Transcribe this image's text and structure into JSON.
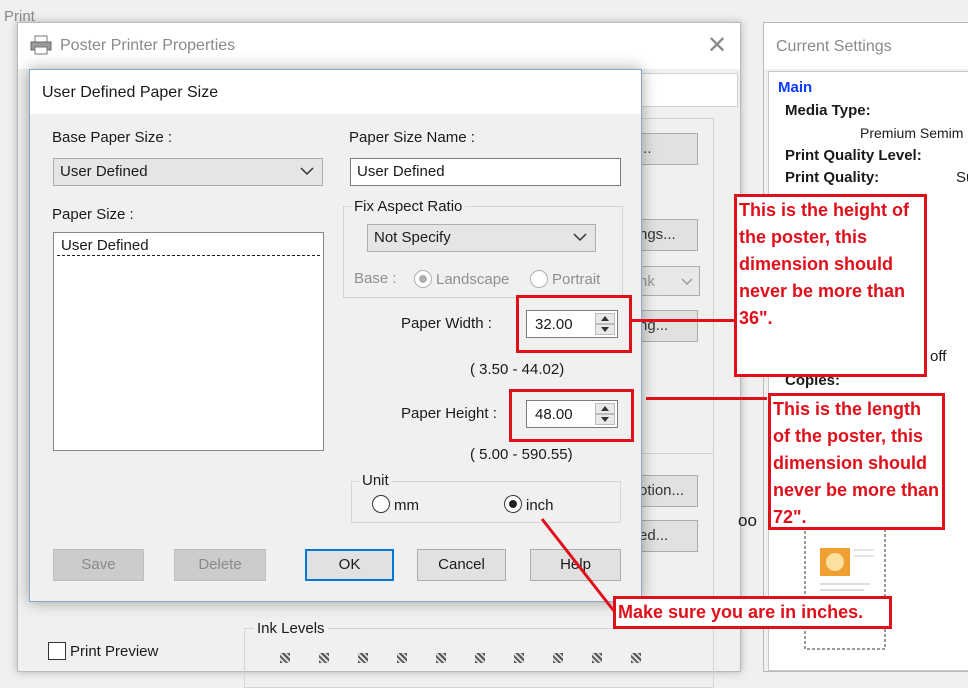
{
  "background_window": {
    "title": "Print"
  },
  "properties_window": {
    "title": "Poster Printer Properties",
    "close_glyph": "✕",
    "buttons": [
      {
        "label": "..."
      },
      {
        "label": "ngs..."
      },
      {
        "label": "nk"
      },
      {
        "label": "ng..."
      },
      {
        "label": "otion..."
      },
      {
        "label": "ed..."
      }
    ],
    "print_preview_label": "Print Preview",
    "ink_levels_label": "Ink Levels"
  },
  "current_settings": {
    "title": "Current Settings",
    "section": "Main",
    "lines": [
      {
        "text": "Media Type:",
        "bold": true
      },
      {
        "text": "Premium Semim",
        "bold": false
      },
      {
        "text": "Print Quality Level:",
        "bold": true
      },
      {
        "text": "Print Quality:",
        "bold": true
      },
      {
        "text": "Su",
        "bold": false
      },
      {
        "text": "off",
        "bold": false
      },
      {
        "text": "Copies:",
        "bold": true
      },
      {
        "text": "oo",
        "bold": false
      }
    ]
  },
  "dialog": {
    "title": "User Defined Paper Size",
    "base_paper_size_label": "Base Paper Size :",
    "base_paper_size_value": "User Defined",
    "paper_size_label": "Paper Size :",
    "paper_size_items": [
      "User Defined"
    ],
    "paper_size_name_label": "Paper Size Name :",
    "paper_size_name_value": "User Defined",
    "fix_aspect_ratio_label": "Fix Aspect Ratio",
    "fix_aspect_ratio_value": "Not Specify",
    "base_label": "Base :",
    "landscape_label": "Landscape",
    "portrait_label": "Portrait",
    "paper_width_label": "Paper Width :",
    "paper_width_value": "32.00",
    "paper_width_range": "( 3.50 - 44.02)",
    "paper_height_label": "Paper Height :",
    "paper_height_value": "48.00",
    "paper_height_range": "( 5.00 - 590.55)",
    "unit_label": "Unit",
    "unit_mm_label": "mm",
    "unit_inch_label": "inch",
    "unit_selected": "inch",
    "buttons": {
      "save": "Save",
      "delete": "Delete",
      "ok": "OK",
      "cancel": "Cancel",
      "help": "Help"
    }
  },
  "annotations": {
    "height_note": "This is the height of the poster, this dimension should never be more than 36\".",
    "length_note": "This is the length of the poster, this dimension should never be more than 72\".",
    "inches_note": "Make sure you are in inches.",
    "color": "#e0101b"
  }
}
